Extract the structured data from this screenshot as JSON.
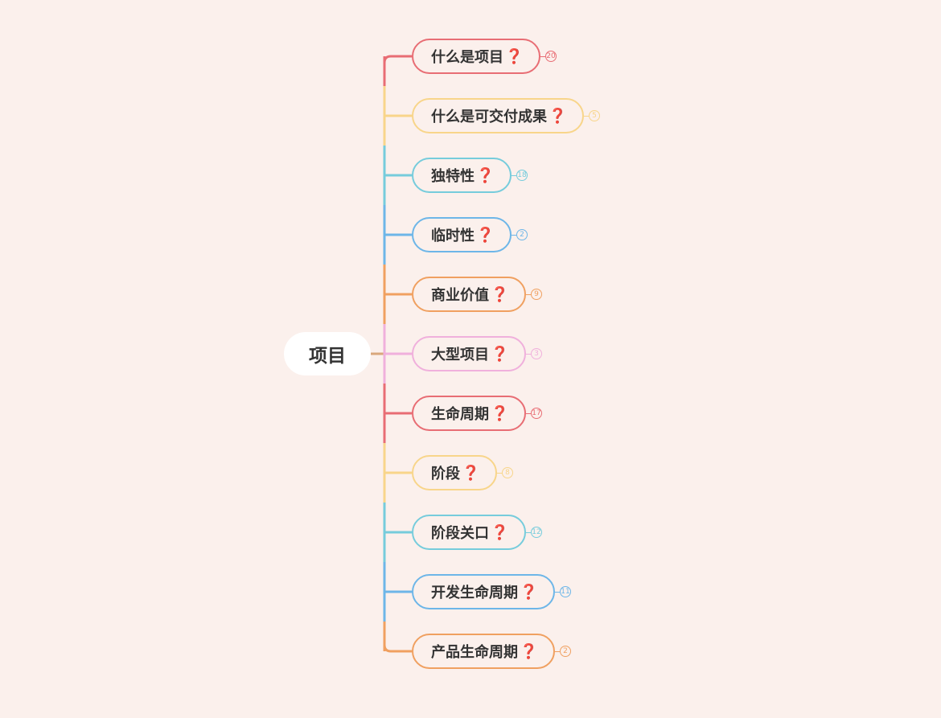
{
  "root": {
    "label": "项目"
  },
  "question_icon": "red-question-mark-icon",
  "question_glyph": "❓",
  "colors": {
    "background": "#fbf0ec",
    "trunk": "#d9a77c"
  },
  "topics": [
    {
      "label": "什么是项目",
      "count": "20",
      "color": "#e86d74"
    },
    {
      "label": "什么是可交付成果",
      "count": "5",
      "color": "#f8d58a"
    },
    {
      "label": "独特性",
      "count": "18",
      "color": "#76ccdc"
    },
    {
      "label": "临时性",
      "count": "2",
      "color": "#6db6e8"
    },
    {
      "label": "商业价值",
      "count": "9",
      "color": "#f0a060"
    },
    {
      "label": "大型项目",
      "count": "3",
      "color": "#f0b0dc"
    },
    {
      "label": "生命周期",
      "count": "17",
      "color": "#e86d74"
    },
    {
      "label": "阶段",
      "count": "8",
      "color": "#f8d58a"
    },
    {
      "label": "阶段关口",
      "count": "12",
      "color": "#76ccdc"
    },
    {
      "label": "开发生命周期",
      "count": "11",
      "color": "#6db6e8"
    },
    {
      "label": "产品生命周期",
      "count": "2",
      "color": "#f0a060"
    }
  ]
}
